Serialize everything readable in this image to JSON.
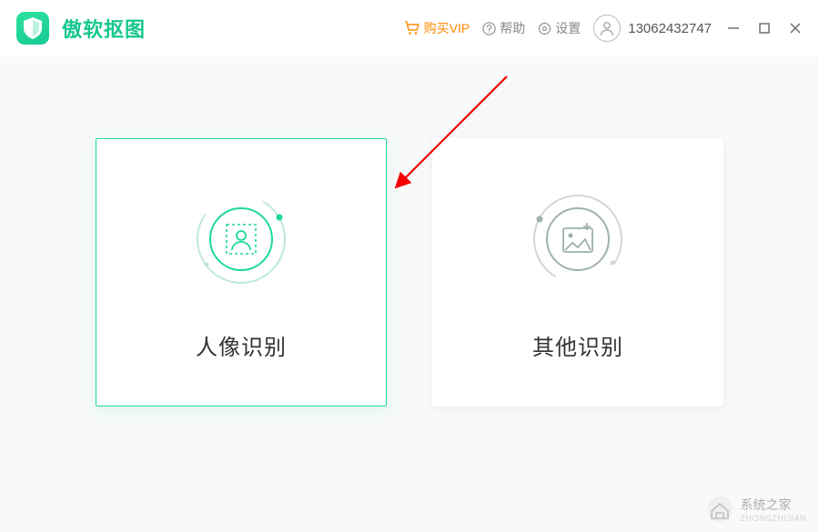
{
  "titlebar": {
    "app_name": "傲软抠图",
    "vip_label": "购买VIP",
    "help_label": "帮助",
    "settings_label": "设置",
    "user_id": "13062432747"
  },
  "cards": {
    "portrait": {
      "label": "人像识别",
      "selected": true
    },
    "other": {
      "label": "其他识别",
      "selected": false
    }
  },
  "watermark": {
    "main": "系统之家",
    "sub": "ZHONGZHIJIAN"
  }
}
